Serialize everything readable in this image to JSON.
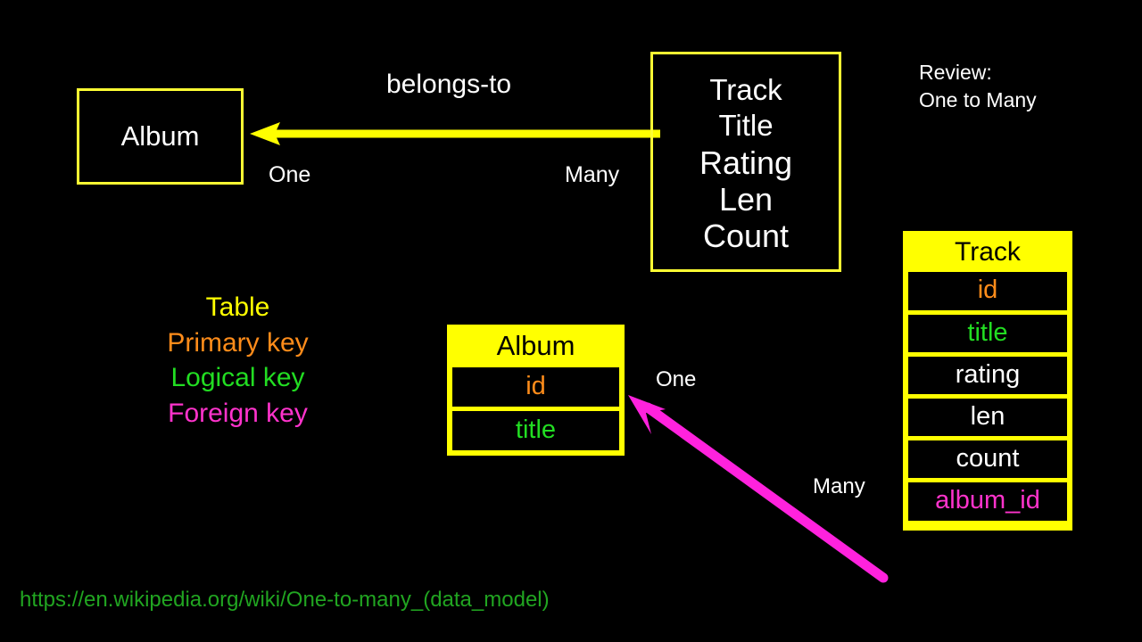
{
  "slide": {
    "background_color": "#000000",
    "note": {
      "text": "Review:\nOne to Many"
    }
  },
  "conceptual": {
    "album_box": {
      "title": "Album"
    },
    "track_box": {
      "lines_primary": [
        "Track",
        "Title"
      ],
      "lines_secondary": [
        "Rating",
        "Len",
        "Count"
      ]
    },
    "relationship": {
      "label": "belongs-to",
      "one_label": "One",
      "many_label": "Many",
      "arrow_color": "#ffff00",
      "arrow_direction": "right-to-left"
    }
  },
  "legend": {
    "items": [
      {
        "label": "Table",
        "color": "#ffff00"
      },
      {
        "label": "Primary key",
        "color": "#ff8c1a"
      },
      {
        "label": "Logical key",
        "color": "#22dd22"
      },
      {
        "label": "Foreign key",
        "color": "#ff33cc"
      }
    ]
  },
  "physical": {
    "album_table": {
      "name": "Album",
      "header_bg": "#ffff00",
      "header_fg": "#000000",
      "columns": [
        {
          "name": "id",
          "color": "#ff8c1a"
        },
        {
          "name": "title",
          "color": "#22dd22"
        }
      ]
    },
    "track_table": {
      "name": "Track",
      "header_bg": "#ffff00",
      "header_fg": "#000000",
      "columns": [
        {
          "name": "id",
          "color": "#ff8c1a"
        },
        {
          "name": "title",
          "color": "#22dd22"
        },
        {
          "name": "rating",
          "color": "#ffffff"
        },
        {
          "name": "len",
          "color": "#ffffff"
        },
        {
          "name": "count",
          "color": "#ffffff"
        },
        {
          "name": "album_id",
          "color": "#ff33cc"
        }
      ]
    },
    "relationship": {
      "one_label": "One",
      "many_label": "Many",
      "arrow_color": "#ff22dd",
      "arrow_direction": "bottom-right-to-top-left"
    }
  },
  "footer": {
    "source_url": "https://en.wikipedia.org/wiki/One-to-many_(data_model)",
    "source_url_color": "#21a521"
  }
}
